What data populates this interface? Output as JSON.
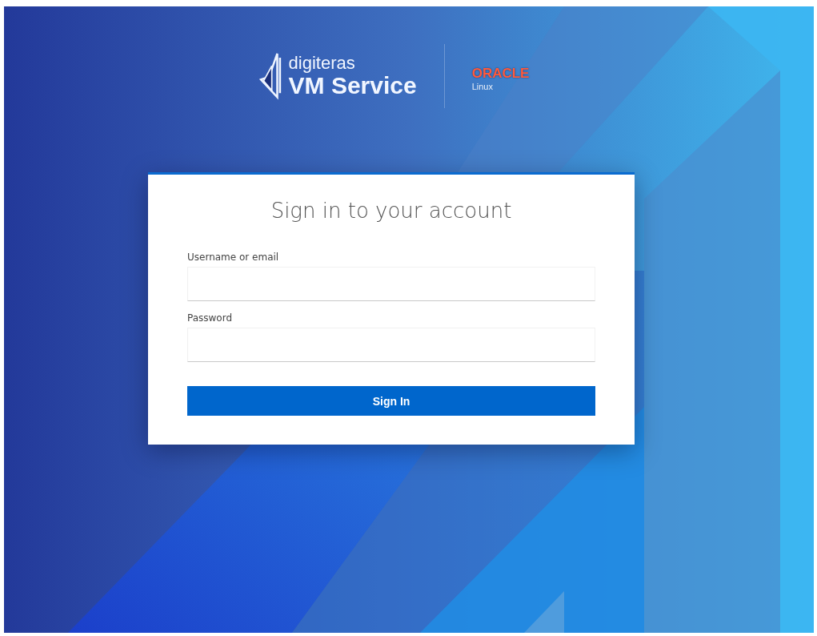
{
  "header": {
    "brand": "digiteras",
    "product": "VM Service",
    "partner": "ORACLE",
    "partner_sub": "Linux"
  },
  "login": {
    "title": "Sign in to your account",
    "fields": [
      {
        "label": "Username or email"
      },
      {
        "label": "Password"
      }
    ],
    "button": "Sign In"
  }
}
